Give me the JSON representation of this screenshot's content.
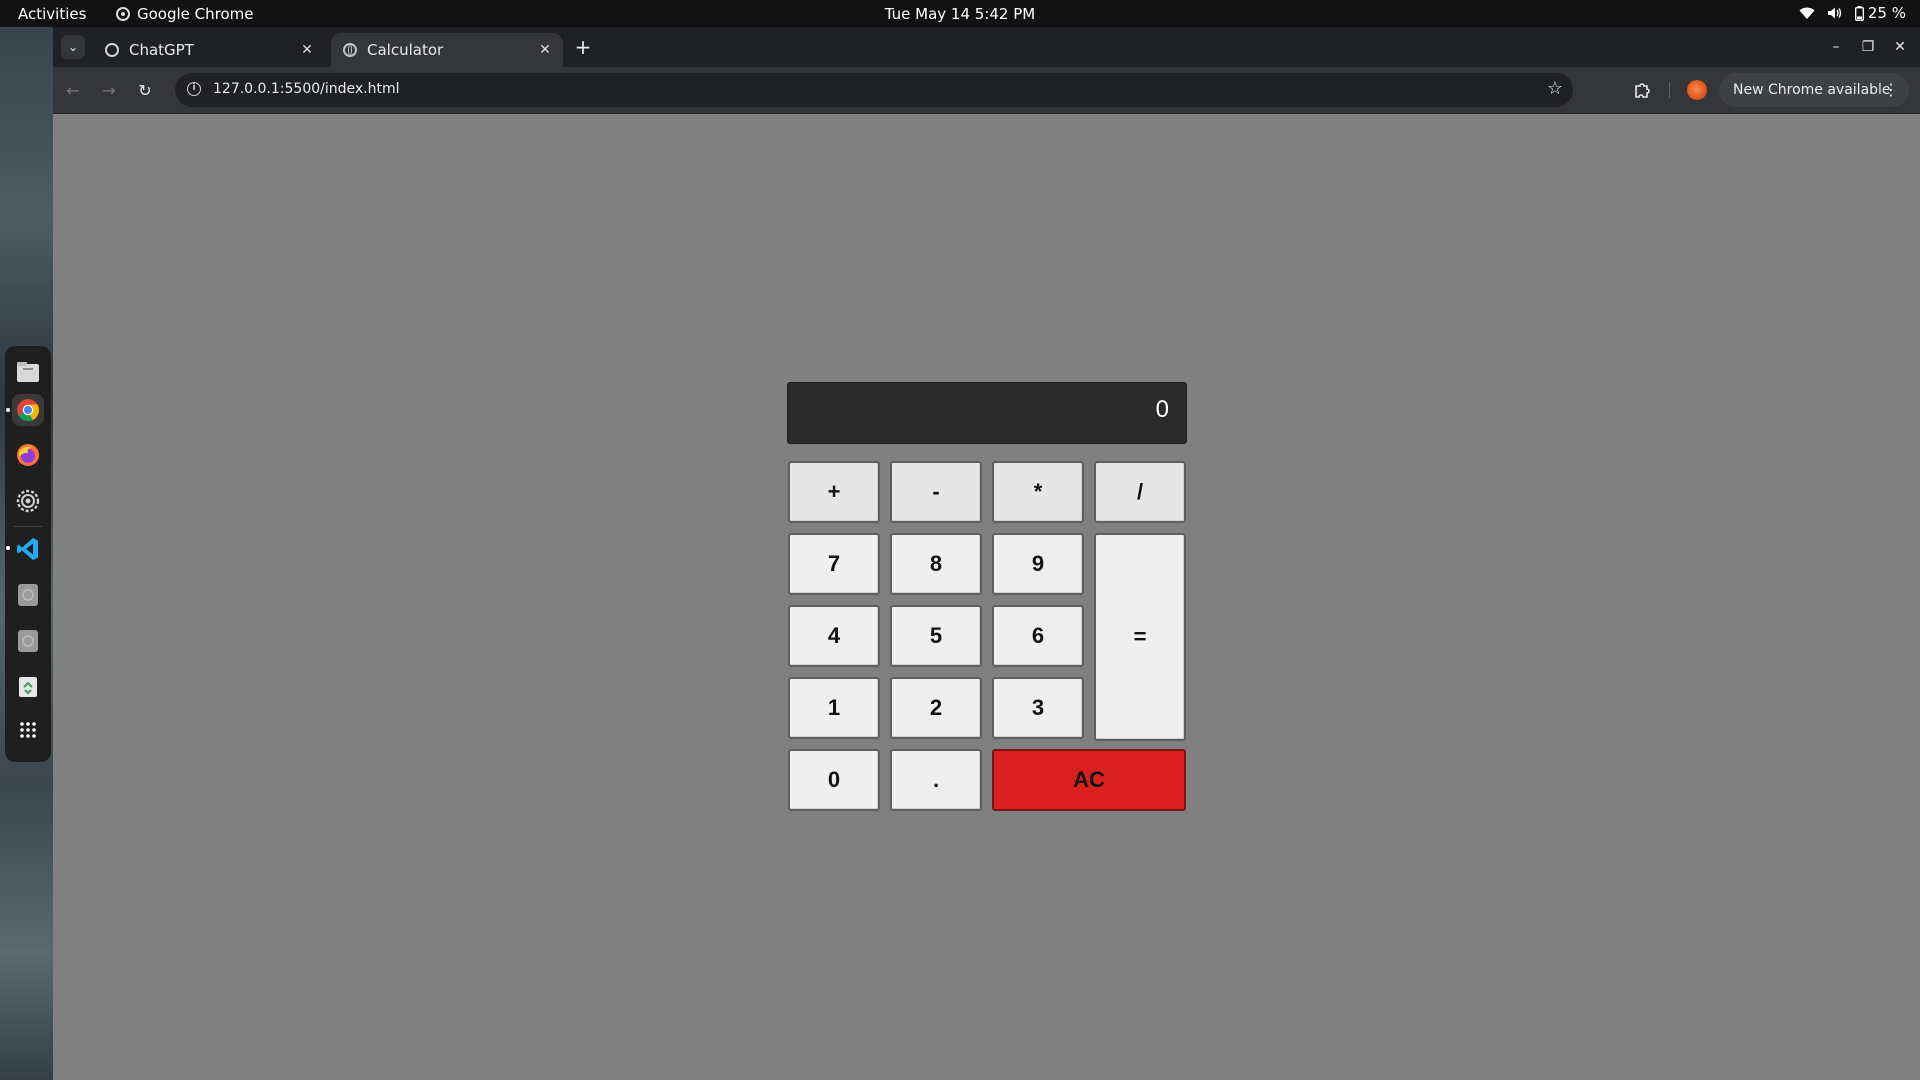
{
  "topbar": {
    "activities": "Activities",
    "app_name": "Google Chrome",
    "clock": "Tue May 14  5:42 PM",
    "battery": "25 %",
    "icons": [
      "wifi-icon",
      "volume-icon",
      "battery-icon"
    ]
  },
  "dock": {
    "items": [
      "files",
      "google-chrome",
      "firefox",
      "settings",
      "vscode",
      "disk",
      "disk",
      "trash",
      "show-apps"
    ]
  },
  "browser": {
    "tabs": [
      {
        "title": "ChatGPT",
        "active": false,
        "favicon": "chatgpt-icon"
      },
      {
        "title": "Calculator",
        "active": true,
        "favicon": "globe-icon"
      }
    ],
    "new_tab": "+",
    "url": "127.0.0.1:5500/index.html",
    "update_label": "New Chrome available"
  },
  "calculator": {
    "display": "0",
    "operators": [
      "+",
      "-",
      "*",
      "/"
    ],
    "digits": {
      "seven": "7",
      "eight": "8",
      "nine": "9",
      "four": "4",
      "five": "5",
      "six": "6",
      "one": "1",
      "two": "2",
      "three": "3",
      "zero": "0",
      "dot": "."
    },
    "equals": "=",
    "clear": "AC",
    "colors": {
      "clear_button": "#da1f1f",
      "display_bg": "#2b2b2b",
      "page_bg": "#808080",
      "key_bg": "#efefef"
    }
  }
}
